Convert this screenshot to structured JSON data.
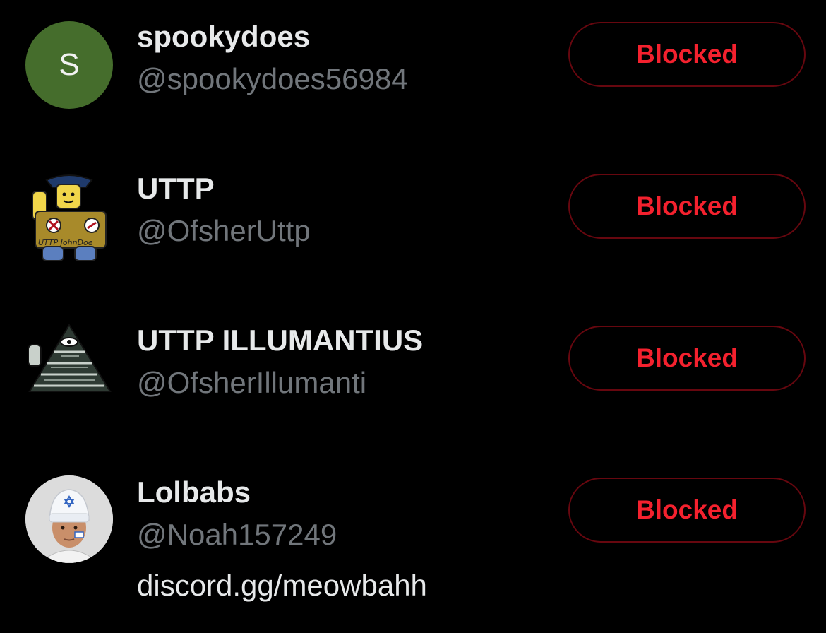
{
  "accounts": [
    {
      "display_name": "spookydoes",
      "handle": "@spookydoes56984",
      "avatar_initial": "S",
      "bio": "",
      "button_label": "Blocked"
    },
    {
      "display_name": "UTTP",
      "handle": "@OfsherUttp",
      "avatar_icon": "roblox-character-avatar",
      "avatar_text": "UTTP JohnDoe",
      "bio": "",
      "button_label": "Blocked"
    },
    {
      "display_name": "UTTP ILLUMANTIUS",
      "handle": "@OfsherIllumanti",
      "avatar_icon": "illuminati-pyramid-avatar",
      "bio": "",
      "button_label": "Blocked"
    },
    {
      "display_name": "Lolbabs",
      "handle": "@Noah157249",
      "avatar_icon": "person-photo-avatar",
      "bio": "discord.gg/meowbahh",
      "button_label": "Blocked"
    }
  ],
  "colors": {
    "background": "#000000",
    "name": "#e7e9ea",
    "handle": "#71767b",
    "blocked_text": "#f4212e",
    "blocked_border": "#67070f",
    "avatar_green": "#456d2c"
  }
}
